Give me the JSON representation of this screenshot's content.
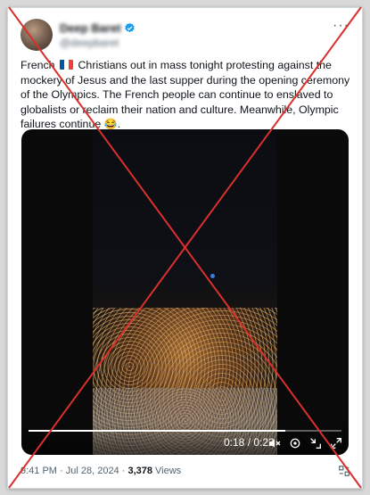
{
  "tweet": {
    "author_name": "Deep Baret",
    "author_handle": "@deepbaret",
    "more_label": "···",
    "text_before_flag": "French",
    "text_after_flag": " Christians out in mass tonight protesting against the mockery of Jesus and the last supper during the opening ceremony of the Olympics. The French people can continue to enslaved to globalists or reclaim their nation and culture. Meanwhile, Olympic failures continue",
    "text_end": ".",
    "emoji": "😂",
    "timestamp": "9:41 PM · Jul 28, 2024 · ",
    "views_count": "3,378",
    "views_label": " Views"
  },
  "video": {
    "gif_label": "",
    "elapsed": "0:18",
    "duration": "0:22",
    "time_separator": " / ",
    "progress_fraction": 0.82
  },
  "colors": {
    "overlay_x": "#d9302c",
    "verified": "#1d9bf0",
    "flag_blue": "#0055a4",
    "flag_white": "#ffffff",
    "flag_red": "#ef4135"
  },
  "icons": [
    "verified-badge-icon",
    "more-icon",
    "volume-icon",
    "settings-icon",
    "collapse-icon",
    "fullscreen-icon",
    "grok-icon"
  ]
}
